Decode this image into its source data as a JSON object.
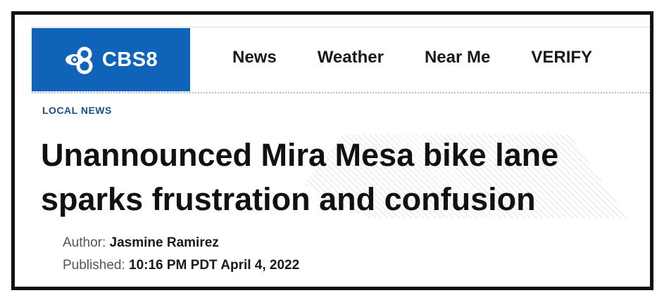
{
  "brand": {
    "logo_text": "CBS8",
    "logo_mark": "cbs-eye-8-icon",
    "color": "#0f63b8"
  },
  "nav": {
    "items": [
      {
        "label": "News"
      },
      {
        "label": "Weather"
      },
      {
        "label": "Near Me"
      },
      {
        "label": "VERIFY"
      }
    ]
  },
  "article": {
    "category": "LOCAL NEWS",
    "headline": "Unannounced Mira Mesa bike lane sparks frustration and confusion",
    "author_label": "Author:",
    "author": "Jasmine Ramirez",
    "published_label": "Published:",
    "published": "10:16 PM PDT April 4, 2022"
  }
}
